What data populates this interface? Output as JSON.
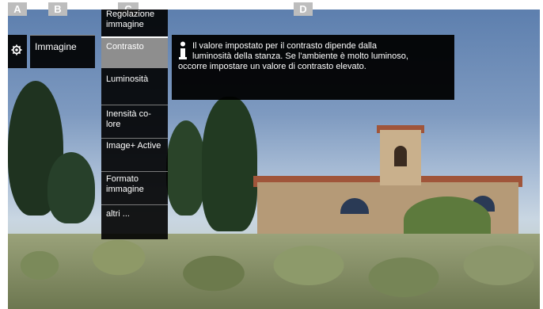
{
  "markers": {
    "a": "A",
    "b": "B",
    "c": "C",
    "d": "D"
  },
  "menu": {
    "category": "Immagine",
    "submenu_title": "Regolazione immagine",
    "items": [
      {
        "label": "Contrasto",
        "selected": true
      },
      {
        "label": "Luminosità",
        "selected": false
      },
      {
        "label": "Inensità co-lore",
        "selected": false
      },
      {
        "label": "Image+ Active",
        "selected": false
      },
      {
        "label": "Formato immagine",
        "selected": false
      },
      {
        "label": "altri ...",
        "selected": false
      }
    ]
  },
  "info": {
    "line1": "Il valore impostato per il contrasto dipende dalla",
    "line2": "luminosità della stanza. Se l'ambiente è molto luminoso,",
    "line3": "occorre impostare un valore di contrasto elevato."
  },
  "icons": {
    "settings": "gear-icon",
    "info": "info-icon"
  }
}
